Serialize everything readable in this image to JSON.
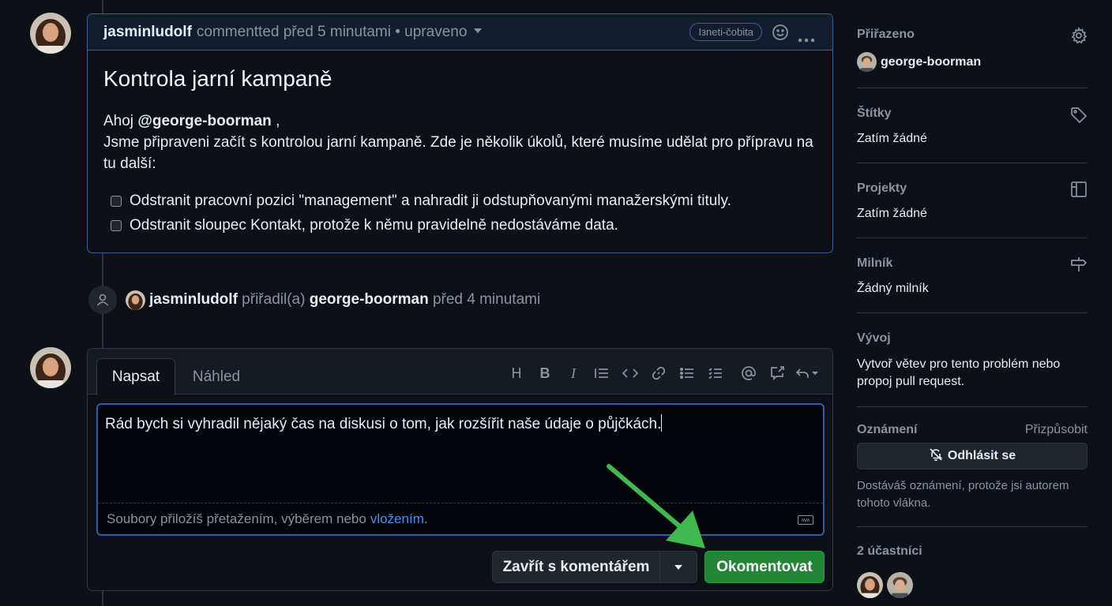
{
  "comment": {
    "author": "jasminludolf",
    "meta": "commentted před 5 minutami • upraveno",
    "badge": "Iзneti-čobita",
    "title": "Kontrola jarní kampaně",
    "greeting": "Ahoj",
    "mention": "@george-boorman",
    "greeting_suffix": " ,",
    "body": "Jsme připraveni začít s kontrolou jarní kampaně. Zde je několik úkolů, které musíme udělat pro přípravu na tu další:",
    "tasks": [
      "Odstranit pracovní pozici \"management\" a nahradit ji odstupňovanými manažerskými tituly.",
      "Odstranit sloupec Kontakt, protože k němu pravidelně nedostáváme data."
    ]
  },
  "event": {
    "actor": "jasminludolf",
    "action": " přiřadil(a) ",
    "target": "george-boorman",
    "time": " před 4 minutami"
  },
  "editor": {
    "tab_write": "Napsat",
    "tab_preview": "Náhled",
    "value": "Rád bych si vyhradil nějaký čas na diskusi o tom, jak rozšířit naše údaje o půjčkách.",
    "attach_text": "Soubory přiložíš přetažením, výběrem nebo",
    "attach_link": "vložením",
    "attach_dot": ".",
    "btn_close": "Zavřít s komentářem",
    "btn_comment": "Okomentovat",
    "md_icon": "ʍʍ"
  },
  "sidebar": {
    "assigned_title": "Přiřazeno",
    "assignee": "george-boorman",
    "labels_title": "Štítky",
    "labels_value": "Zatím žádné",
    "projects_title": "Projekty",
    "projects_value": "Zatím žádné",
    "milestone_title": "Milník",
    "milestone_value": "Žádný milník",
    "dev_title": "Vývoj",
    "dev_value": "Vytvoř větev pro tento problém nebo propoj pull request.",
    "notif_title": "Oznámení",
    "notif_customize": "Přizpůsobit",
    "unsub_label": "Odhlásit se",
    "notif_note": "Dostáváš oznámení, protože jsi autorem tohoto vlákna.",
    "participants_title": "2 účastníci"
  },
  "colors": {
    "primary_button": "#238636",
    "accent_border": "#3b5f96",
    "link": "#4493f8",
    "arrow": "#3fb950"
  }
}
